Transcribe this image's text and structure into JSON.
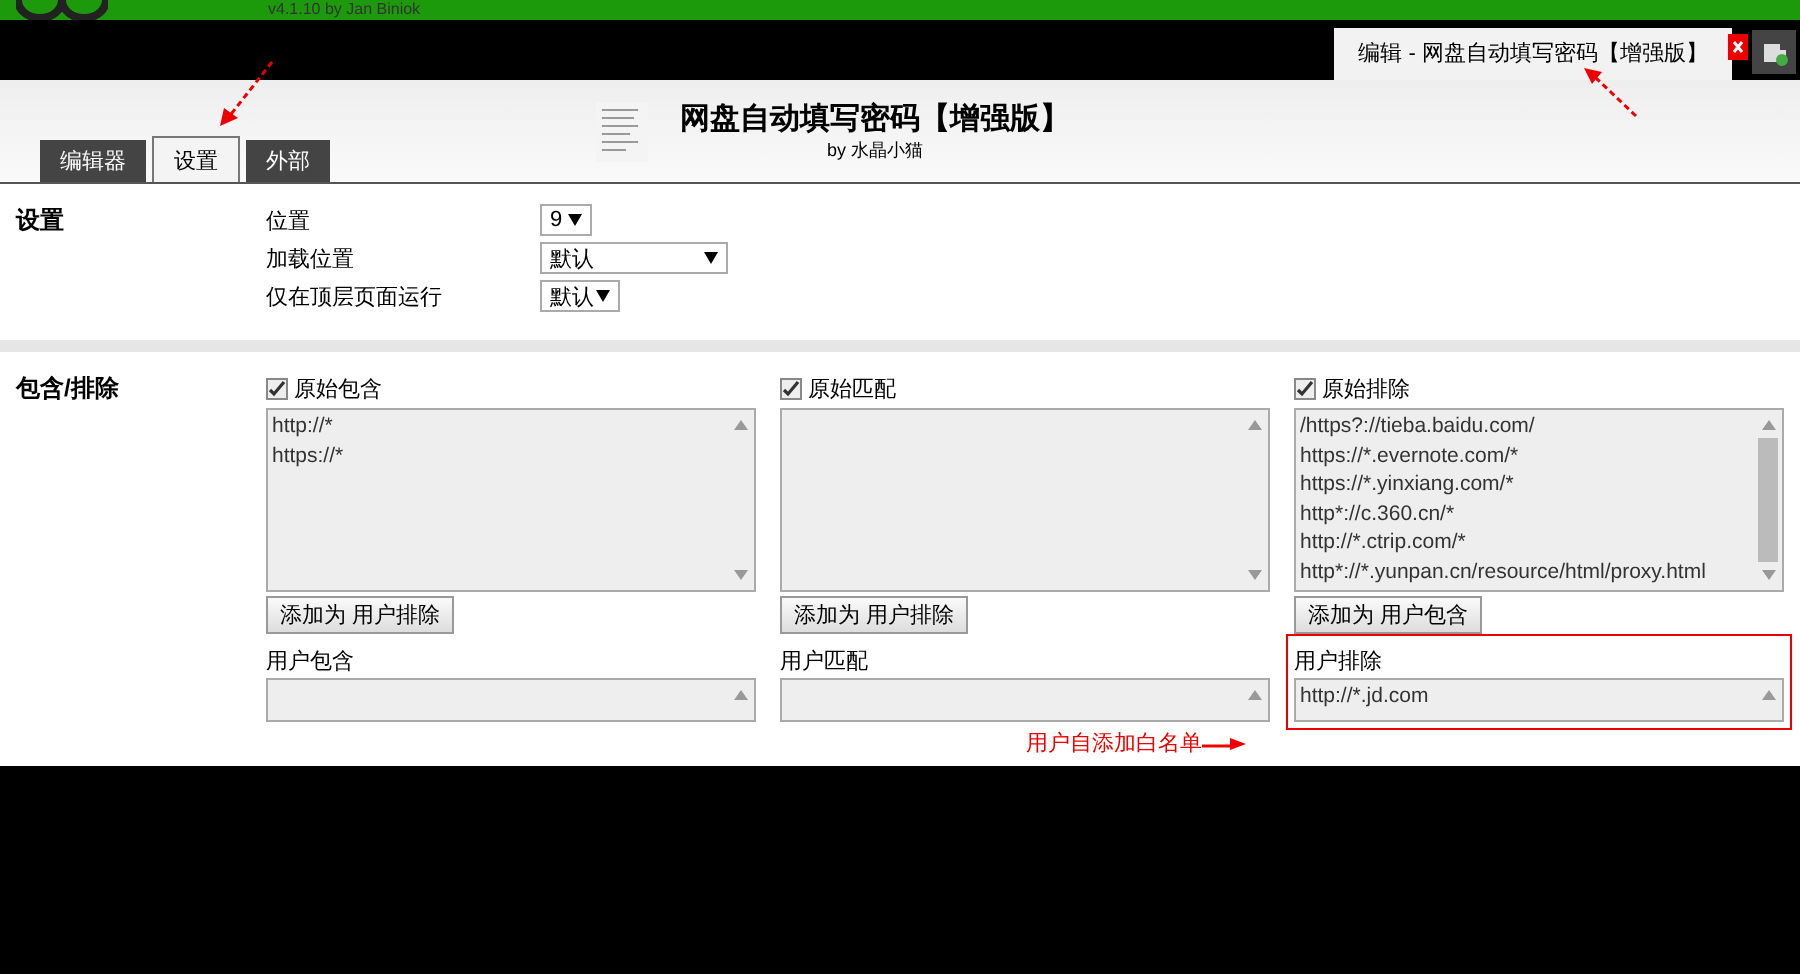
{
  "app_bar": {
    "version": "v4.1.10 by Jan Biniok"
  },
  "browser_tabs": [
    {
      "label": "编辑 - 网盘自动填写密码【增强版】",
      "selected": true
    }
  ],
  "tabs": [
    {
      "label": "编辑器",
      "selected": false
    },
    {
      "label": "设置",
      "selected": true
    },
    {
      "label": "外部",
      "selected": false
    }
  ],
  "script": {
    "title": "网盘自动填写密码【增强版】",
    "author": "by 水晶小猫"
  },
  "settings": {
    "heading": "设置",
    "rows": [
      {
        "label": "位置",
        "value": "9"
      },
      {
        "label": "加载位置",
        "value": "默认"
      },
      {
        "label": "仅在顶层页面运行",
        "value": "默认"
      }
    ]
  },
  "include_exclude": {
    "heading": "包含/排除",
    "columns": [
      {
        "label": "原始包含",
        "checked": true,
        "lines": [
          "http://*",
          "https://*"
        ],
        "button": "添加为 用户排除",
        "user_label": "用户包含",
        "highlighted": false
      },
      {
        "label": "原始匹配",
        "checked": true,
        "button": "添加为 用户排除",
        "user_label": "用户匹配",
        "highlighted": false
      },
      {
        "label": "原始排除",
        "checked": true,
        "lines": [
          "/https?://tieba.baidu.com/",
          "https://*.evernote.com/*",
          "https://*.yinxiang.com/*",
          "http*://c.360.cn/*",
          "http://*.ctrip.com/*",
          "http*://*.yunpan.cn/resource/html/proxy.html"
        ],
        "button": "添加为 用户包含",
        "user_label": "用户排除",
        "user_lines": [
          "http://*.jd.com"
        ],
        "highlighted": true
      }
    ]
  },
  "annotation": {
    "text": "用户自添加白名单"
  }
}
